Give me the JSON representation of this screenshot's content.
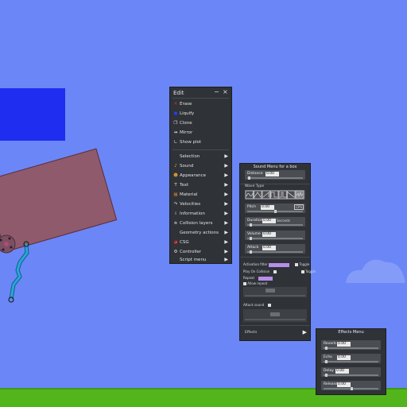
{
  "scene": {
    "colors": {
      "sky": "#6b86f7",
      "ground": "#53b51c",
      "blue_box": "#1f2df0",
      "plank": "#8e5a6c",
      "panel": "#2f3237"
    }
  },
  "edit_menu": {
    "title": "Edit",
    "minimize_icon": "minus-icon",
    "close_icon": "close-icon",
    "actions": [
      {
        "label": "Erase",
        "icon": "x-icon"
      },
      {
        "label": "Liquify",
        "icon": "liquify-icon"
      },
      {
        "label": "Clone",
        "icon": "clone-icon"
      },
      {
        "label": "Mirror",
        "icon": "mirror-icon"
      },
      {
        "label": "Show plot",
        "icon": "plot-icon"
      }
    ],
    "submenus": [
      {
        "label": "Selection",
        "icon": ""
      },
      {
        "label": "Sound",
        "icon": "sound-icon"
      },
      {
        "label": "Appearance",
        "icon": "appearance-icon"
      },
      {
        "label": "Text",
        "icon": "text-icon"
      },
      {
        "label": "Material",
        "icon": "material-icon"
      },
      {
        "label": "Velocities",
        "icon": "velocities-icon"
      },
      {
        "label": "Information",
        "icon": "info-icon"
      },
      {
        "label": "Collision layers",
        "icon": "layers-icon"
      },
      {
        "label": "Geometry actions",
        "icon": ""
      },
      {
        "label": "CSG",
        "icon": "csg-icon"
      },
      {
        "label": "Controller",
        "icon": "controller-icon"
      },
      {
        "label": "Script menu",
        "icon": ""
      }
    ]
  },
  "sound_menu": {
    "header": "Sound Menu for a box",
    "distance_label": "Distance",
    "distance_value": "0.00",
    "wave_type_label": "Wave Type",
    "wave_buttons": 7,
    "sliders": [
      {
        "label": "Pitch",
        "value": "0.00",
        "extra": "CPS",
        "fraction": 0.5
      },
      {
        "label": "Duration",
        "value": "0.00",
        "extra": "Seconds",
        "fraction": 0.05
      },
      {
        "label": "Volume",
        "value": "0.00",
        "extra": "",
        "fraction": 0.05
      },
      {
        "label": "Attack",
        "value": "0.00",
        "extra": "",
        "fraction": 0.05
      }
    ],
    "activation_label": "Activation filter",
    "activation_value": "",
    "toggle1": "Toggle",
    "play_on_collision": "Play On Collision",
    "toggle2": "Toggle",
    "repeat_label": "Repeat",
    "repeat_value": "",
    "allow_repeat": "Allow repeat",
    "fade_label": "Attack sound",
    "effects_label": "Effects"
  },
  "effects_menu": {
    "header": "Effects Menu",
    "sliders": [
      {
        "label": "Reverb",
        "value": "0.00",
        "fraction": 0.03
      },
      {
        "label": "Echo",
        "value": "0.00",
        "fraction": 0.03
      },
      {
        "label": "Delay",
        "value": "0.00",
        "fraction": 0.03
      },
      {
        "label": "Release",
        "value": "0.00",
        "fraction": 0.5
      }
    ]
  }
}
